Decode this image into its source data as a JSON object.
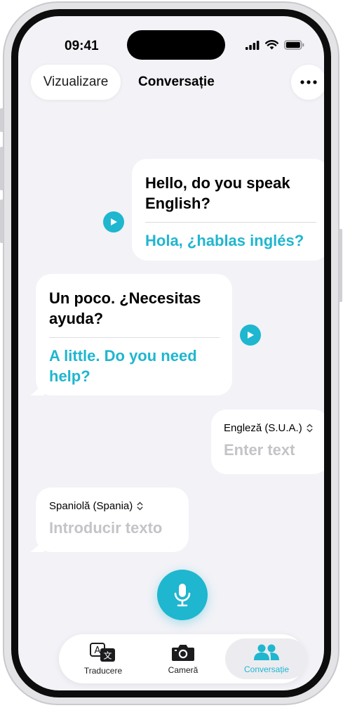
{
  "status": {
    "time": "09:41"
  },
  "nav": {
    "view_button": "Vizualizare",
    "title": "Conversație"
  },
  "messages": [
    {
      "original": "Hello, do you speak English?",
      "translation": "Hola, ¿hablas inglés?"
    },
    {
      "original": "Un poco. ¿Necesitas ayuda?",
      "translation": "A little. Do you need help?"
    }
  ],
  "inputs": [
    {
      "language": "Engleză (S.U.A.)",
      "placeholder": "Enter text"
    },
    {
      "language": "Spaniolă (Spania)",
      "placeholder": "Introducir texto"
    }
  ],
  "tabs": [
    {
      "label": "Traducere",
      "icon": "translate-icon"
    },
    {
      "label": "Cameră",
      "icon": "camera-icon"
    },
    {
      "label": "Conversație",
      "icon": "people-icon"
    }
  ],
  "colors": {
    "accent": "#1fb6cf",
    "background": "#f2f2f7",
    "placeholder": "#c4c4c8"
  }
}
